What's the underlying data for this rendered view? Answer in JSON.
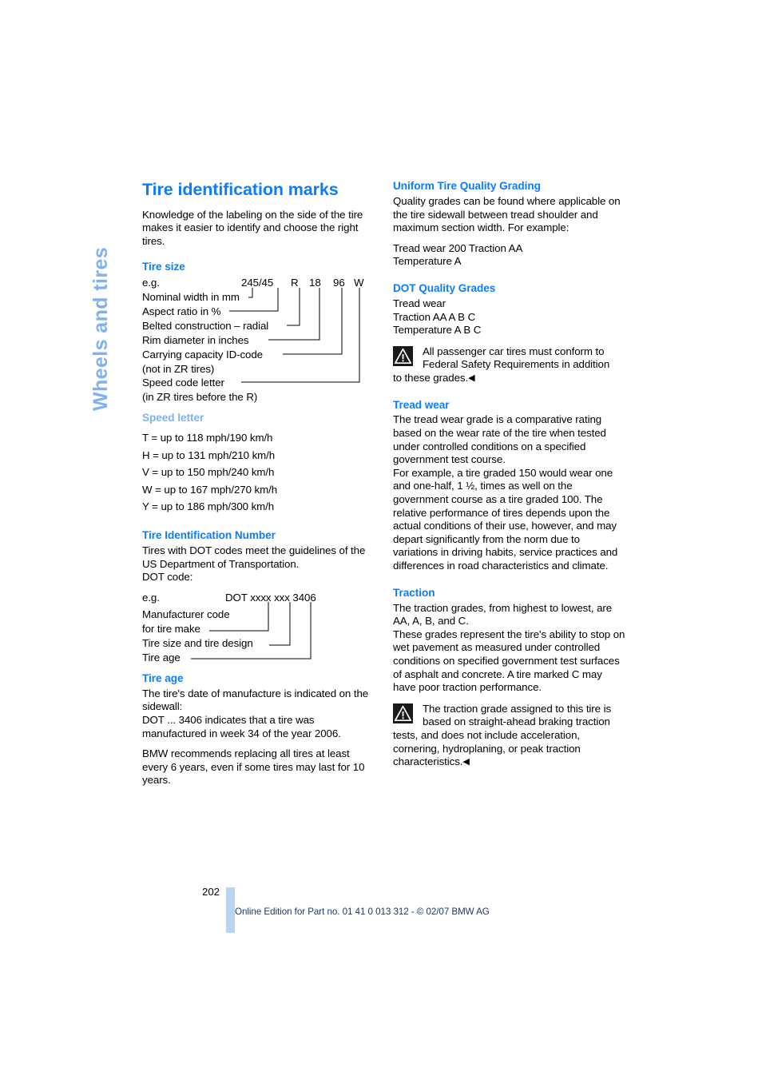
{
  "page": {
    "side_tab": "Wheels and tires",
    "number": "202",
    "footer": "Online Edition for Part no. 01 41 0 013 312 - © 02/07 BMW AG",
    "colors": {
      "heading_blue": "#0C7CFF",
      "light_blue": "#7FB2F0",
      "footer_bar": "#B9D3F2",
      "footer_text": "#1B3A66"
    }
  },
  "left_column": {
    "title": "Tire identification marks",
    "intro": "Knowledge of the labeling on the side of the tire makes it easier to identify and choose the right tires.",
    "tire_size": {
      "heading": "Tire size",
      "eg_label": "e.g.",
      "code_parts": [
        "245/45",
        "R",
        "18",
        "96",
        "W"
      ],
      "labels": [
        "Nominal width in mm",
        "Aspect ratio in %",
        "Belted construction – radial",
        "Rim diameter in inches",
        "Carrying capacity ID-code",
        "(not in ZR tires)",
        "Speed code letter",
        "(in ZR tires before the R)"
      ]
    },
    "speed_letter": {
      "heading": "Speed letter",
      "items": [
        "T = up to 118 mph/190 km/h",
        "H = up to 131 mph/210 km/h",
        "V = up to 150 mph/240 km/h",
        "W = up to 167 mph/270 km/h",
        "Y = up to 186 mph/300 km/h"
      ]
    },
    "tin": {
      "heading": "Tire Identification Number",
      "body": "Tires with DOT codes meet the guidelines of the US Department of Transportation.",
      "dot_label": "DOT code:",
      "eg_label": "e.g.",
      "code": "DOT xxxx xxx 3406",
      "labels": [
        "Manufacturer code",
        "for tire make",
        "Tire size and tire design",
        "Tire age"
      ]
    },
    "tire_age": {
      "heading": "Tire age",
      "para1": "The tire's date of manufacture is indicated on the sidewall:",
      "para2": "DOT ... 3406 indicates that a tire was manufactured in week 34 of the year 2006.",
      "para3": "BMW recommends replacing all tires at least every 6 years, even if some tires may last for 10 years."
    }
  },
  "right_column": {
    "utqg": {
      "heading": "Uniform Tire Quality Grading",
      "body": "Quality grades can be found where applicable on the tire sidewall between tread shoulder and maximum section width. For example:",
      "example_lines": [
        "Tread wear 200 Traction AA",
        "Temperature A"
      ]
    },
    "dot_quality": {
      "heading": "DOT Quality Grades",
      "items": [
        "Tread wear",
        "Traction AA A B C",
        "Temperature A B C"
      ],
      "note_line1": "All passenger car tires must conform to",
      "note_line2": "Federal Safety Requirements in addition",
      "note_rest": "to these grades.",
      "note_endmark": "◀",
      "note_icon": "warning-triangle-icon"
    },
    "tread_wear": {
      "heading": "Tread wear",
      "para1": "The tread wear grade is a comparative rating based on the wear rate of the tire when tested under controlled conditions on a specified government test course.",
      "para2": "For example, a tire graded 150 would wear one and one-half, 1 ½, times as well on the government course as a tire graded 100. The relative performance of tires depends upon the actual conditions of their use, however, and may depart significantly from the norm due to variations in driving habits, service practices and differences in road characteristics and climate."
    },
    "traction": {
      "heading": "Traction",
      "para1": "The traction grades, from highest to lowest, are AA, A, B, and C.",
      "para2": "These grades represent the tire's ability to stop on wet pavement as measured under controlled conditions on specified government test surfaces of asphalt and concrete. A tire marked C may have poor traction performance.",
      "note_line1": "The traction grade assigned to this tire is",
      "note_line2": "based on straight-ahead braking traction",
      "note_rest": "tests, and does not include acceleration, cornering, hydroplaning, or peak traction characteristics.",
      "note_endmark": "◀",
      "note_icon": "warning-triangle-icon"
    }
  }
}
